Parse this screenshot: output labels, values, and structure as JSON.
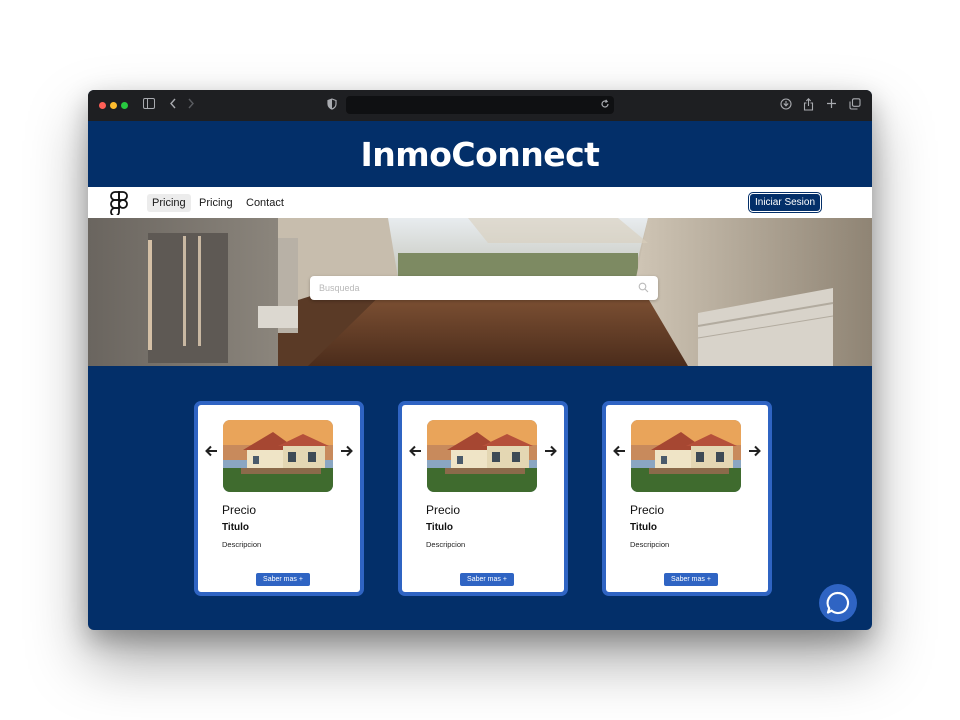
{
  "browser": {
    "toolbar_icons": [
      "sidebar-icon",
      "back-icon",
      "forward-icon",
      "shield-icon",
      "reload-icon",
      "download-icon",
      "share-icon",
      "new-tab-icon",
      "tabs-icon"
    ]
  },
  "site": {
    "brand": "InmoConnect"
  },
  "nav": {
    "items": [
      {
        "label": "Pricing",
        "active": true
      },
      {
        "label": "Pricing",
        "active": false
      },
      {
        "label": "Contact",
        "active": false
      }
    ],
    "login_label": "Iniciar Sesion"
  },
  "search": {
    "placeholder": "Busqueda"
  },
  "listings": [
    {
      "price": "Precio",
      "title": "Titulo",
      "description": "Descripcion",
      "cta": "Saber mas +"
    },
    {
      "price": "Precio",
      "title": "Titulo",
      "description": "Descripcion",
      "cta": "Saber mas +"
    },
    {
      "price": "Precio",
      "title": "Titulo",
      "description": "Descripcion",
      "cta": "Saber mas +"
    }
  ],
  "colors": {
    "primary": "#032f69",
    "accent": "#2f64c3",
    "navbar": "#ffffff"
  }
}
